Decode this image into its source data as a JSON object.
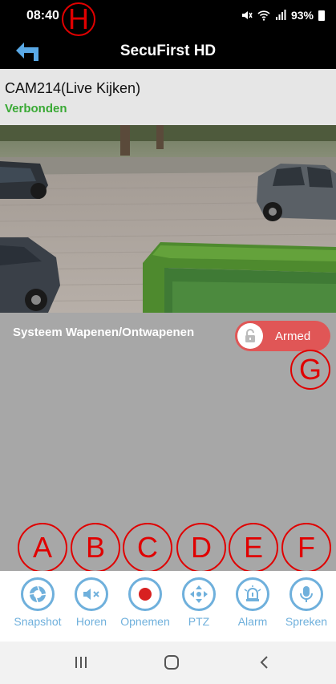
{
  "status_bar": {
    "time": "08:40",
    "battery": "93%"
  },
  "app_bar": {
    "title": "SecuFirst HD"
  },
  "camera": {
    "name": "CAM214(Live Kijken)",
    "connection_status": "Verbonden"
  },
  "arm_control": {
    "label": "Systeem Wapenen/Ontwapenen",
    "toggle_state": "Armed"
  },
  "toolbar": {
    "items": [
      {
        "label": "Snapshot",
        "icon": "camera-shutter-icon"
      },
      {
        "label": "Horen",
        "icon": "speaker-muted-icon"
      },
      {
        "label": "Opnemen",
        "icon": "record-icon"
      },
      {
        "label": "PTZ",
        "icon": "ptz-arrows-icon"
      },
      {
        "label": "Alarm",
        "icon": "alarm-siren-icon"
      },
      {
        "label": "Spreken",
        "icon": "microphone-icon"
      }
    ]
  },
  "annotations": {
    "a": "A",
    "b": "B",
    "c": "C",
    "d": "D",
    "e": "E",
    "f": "F",
    "g": "G",
    "h": "H"
  },
  "colors": {
    "accent": "#6fb0dc",
    "connected": "#3aa935",
    "armed_toggle": "#e05656",
    "annotation": "#e00000"
  }
}
